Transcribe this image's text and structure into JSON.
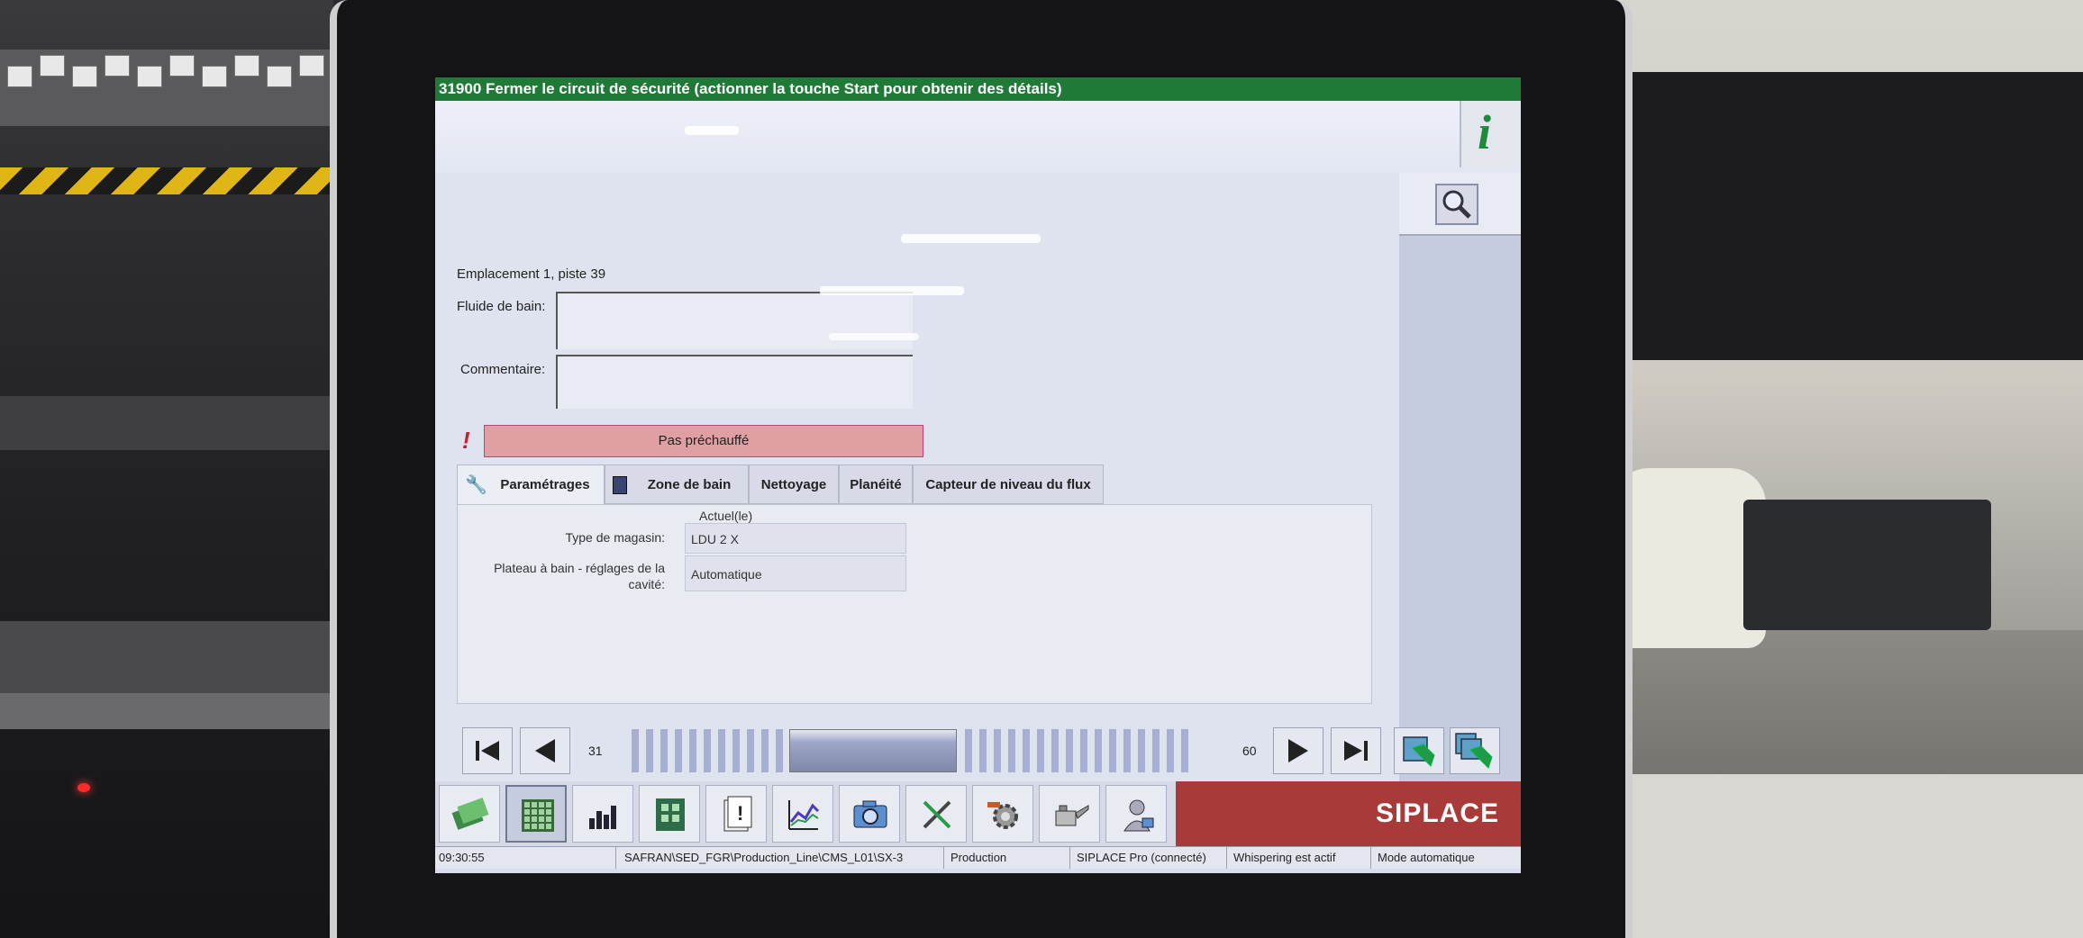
{
  "title_bar": "31900 Fermer le circuit de sécurité (actionner la touche Start pour obtenir des détails)",
  "location": "Emplacement 1, piste 39",
  "fields": {
    "fluid_label": "Fluide de bain:",
    "comment_label": "Commentaire:"
  },
  "warning": {
    "mark": "!",
    "text": "Pas préchauffé"
  },
  "tabs": [
    {
      "label": "Paramétrages",
      "icon": "wrench-icon",
      "active": true
    },
    {
      "label": "Zone de bain",
      "icon": "book-icon",
      "active": false
    },
    {
      "label": "Nettoyage",
      "active": false
    },
    {
      "label": "Planéité",
      "active": false
    },
    {
      "label": "Capteur de niveau du flux",
      "active": false
    }
  ],
  "settings": {
    "column_header": "Actuel(le)",
    "rows": [
      {
        "label": "Type de magasin:",
        "value": "LDU 2 X"
      },
      {
        "label_line1": "Plateau à bain - réglages de la",
        "label_line2": "cavité:",
        "value": "Automatique"
      }
    ]
  },
  "navigation": {
    "page_start": "31",
    "page_end": "60"
  },
  "app_bar": {
    "icons": [
      "feeders-icon",
      "table-grid-icon",
      "bar-chart-icon",
      "board-icon",
      "document-warning-icon",
      "line-chart-icon",
      "camera-icon",
      "tools-icon",
      "gear-settings-icon",
      "oil-can-icon",
      "service-person-icon"
    ],
    "brand": "SIPLACE"
  },
  "status_bar": {
    "time": "09:30:55",
    "path": "SAFRAN\\SED_FGR\\Production_Line\\CMS_L01\\SX-3",
    "mode": "Production",
    "connection": "SIPLACE Pro (connecté)",
    "whisper": "Whispering est actif",
    "auto": "Mode automatique"
  },
  "colors": {
    "title_green": "#1f7a38",
    "warning_pink": "#e0a0a3",
    "brand_red": "#a83a3a",
    "info_green": "#1f8a3c"
  }
}
